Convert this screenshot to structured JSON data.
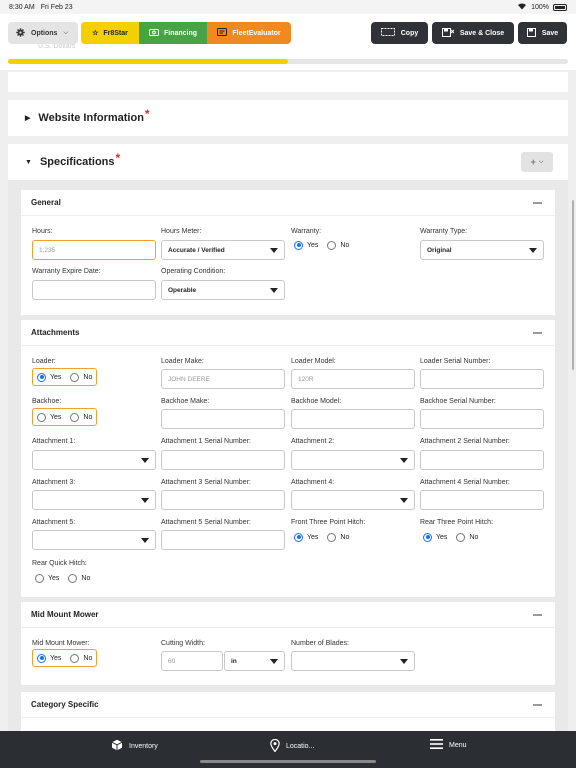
{
  "status": {
    "time": "8:30 AM",
    "date": "Fri Feb 23",
    "battery": "100%"
  },
  "toolbar": {
    "options": "Options",
    "fr8star": "Fr8Star",
    "financing": "Financing",
    "fleetevaluator": "FleetEvaluator",
    "copy": "Copy",
    "save_close": "Save & Close",
    "save": "Save",
    "faint_text": "U.S. Dollars",
    "progress_fraction": 0.5
  },
  "sections": {
    "website": "Website Information",
    "specifications": "Specifications",
    "required_mark": "*"
  },
  "general": {
    "title": "General",
    "hours_label": "Hours:",
    "hours_value": "1,235",
    "hours_meter_label": "Hours Meter:",
    "hours_meter_value": "Accurate / Verified",
    "warranty_label": "Warranty:",
    "warranty_type_label": "Warranty Type:",
    "warranty_type_value": "Original",
    "warranty_expire_label": "Warranty Expire Date:",
    "operating_condition_label": "Operating Condition:",
    "operating_condition_value": "Operable"
  },
  "radio": {
    "yes": "Yes",
    "no": "No"
  },
  "attachments": {
    "title": "Attachments",
    "loader": "Loader:",
    "loader_make": "Loader Make:",
    "loader_make_value": "JOHN DEERE",
    "loader_model": "Loader Model:",
    "loader_model_value": "120R",
    "loader_serial": "Loader Serial Number:",
    "backhoe": "Backhoe:",
    "backhoe_make": "Backhoe Make:",
    "backhoe_model": "Backhoe Model:",
    "backhoe_serial": "Backhoe Serial Number:",
    "att1": "Attachment 1:",
    "att1_serial": "Attachment 1 Serial Number:",
    "att2": "Attachment 2:",
    "att2_serial": "Attachment 2 Serial Number:",
    "att3": "Attachment 3:",
    "att3_serial": "Attachment 3 Serial Number:",
    "att4": "Attachment 4:",
    "att4_serial": "Attachment 4 Serial Number:",
    "att5": "Attachment 5:",
    "att5_serial": "Attachment 5 Serial Number:",
    "front_hitch": "Front Three Point Hitch:",
    "rear_hitch": "Rear Three Point Hitch:",
    "rear_quick_hitch": "Rear Quick Hitch:"
  },
  "mower": {
    "title": "Mid Mount Mower",
    "mower_label": "Mid Mount Mower:",
    "cutting_width_label": "Cutting Width:",
    "cutting_width_value": "60",
    "cutting_width_unit": "in",
    "blades_label": "Number of Blades:"
  },
  "category": {
    "title": "Category Specific"
  },
  "bottom_nav": {
    "inventory": "Inventory",
    "location": "Locatio...",
    "menu": "Menu"
  }
}
